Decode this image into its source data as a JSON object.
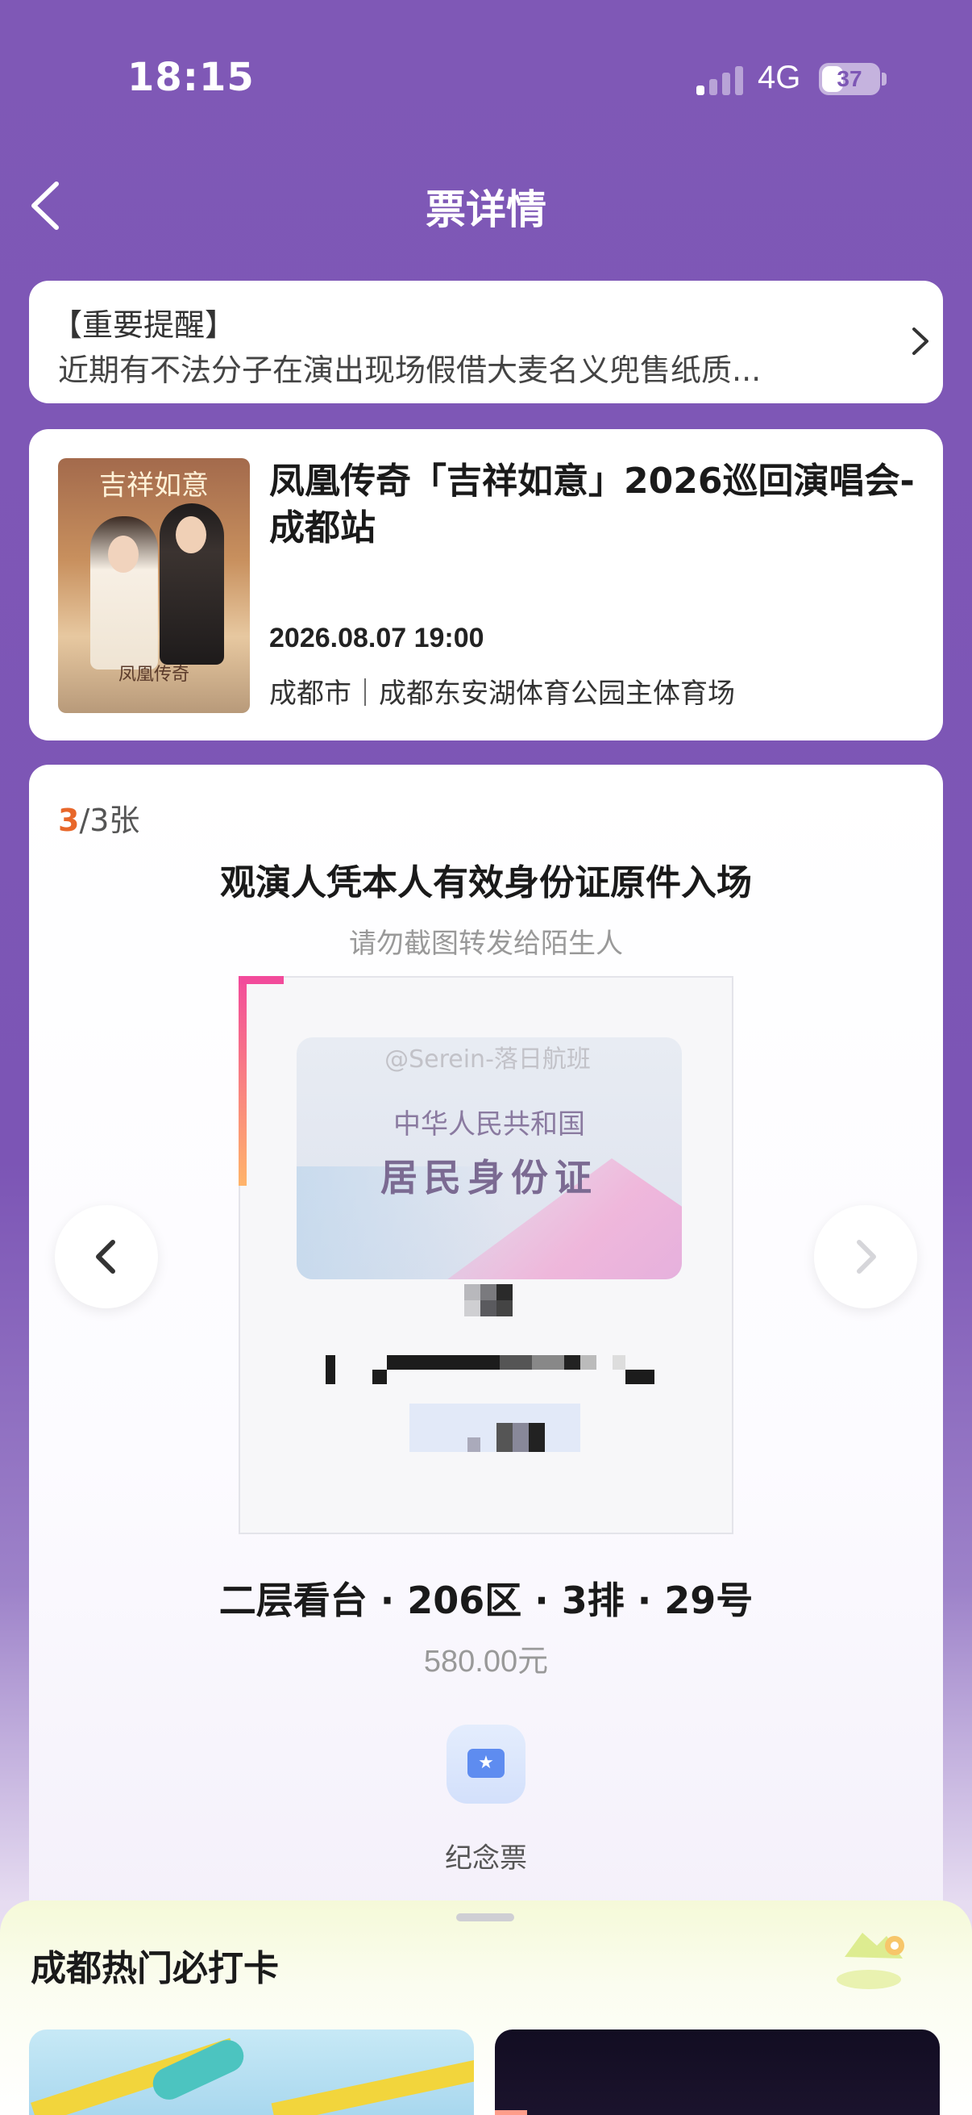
{
  "status_bar": {
    "time": "18:15",
    "network": "4G",
    "battery": "37"
  },
  "nav": {
    "title": "票详情",
    "back_icon": "chevron-left-icon"
  },
  "notice": {
    "title": "【重要提醒】",
    "text": "近期有不法分子在演出现场假借大麦名义兜售纸质..."
  },
  "event": {
    "name": "凤凰传奇「吉祥如意」2026巡回演唱会-成都站",
    "datetime": "2026.08.07 19:00",
    "venue": "成都市｜成都东安湖体育公园主体育场",
    "poster": {
      "title": "吉祥如意",
      "subtitle": "凤凰传奇"
    }
  },
  "ticket": {
    "current": "3",
    "total": "/3张",
    "entry_note": "观演人凭本人有效身份证原件入场",
    "warning": "请勿截图转发给陌生人",
    "id_card": {
      "watermark": "@Serein-落日航班",
      "line1": "中华人民共和国",
      "line2": "居民身份证"
    },
    "seat": "二层看台 · 206区 · 3排 · 29号",
    "price": "580.00元",
    "souvenir_label": "纪念票"
  },
  "bottom_sheet": {
    "title": "成都热门必打卡"
  },
  "colors": {
    "brand_purple": "#7f58b6",
    "accent_orange": "#e8672a",
    "souvenir_blue": "#5e8cf0"
  }
}
